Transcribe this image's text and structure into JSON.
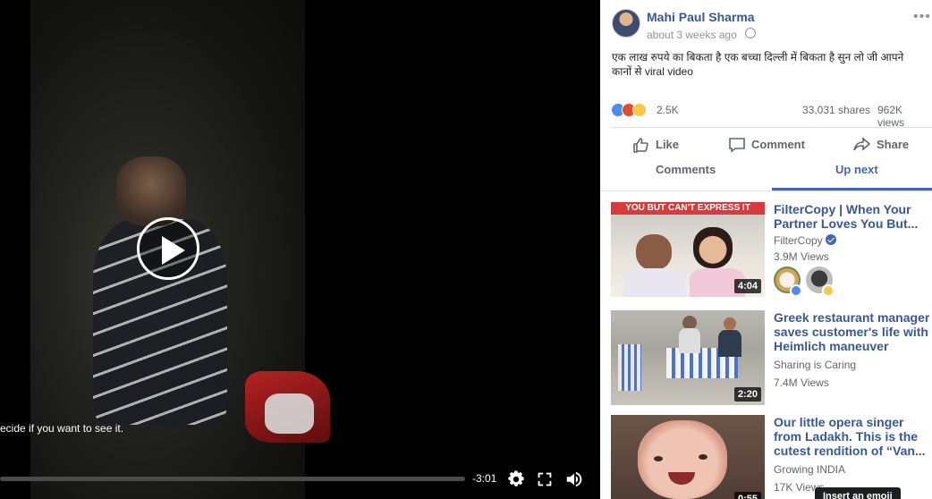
{
  "video": {
    "content_warning": "ecide if you want to see it.",
    "time_remaining": "-3:01",
    "progress": 0.0
  },
  "post": {
    "author": "Mahi Paul Sharma",
    "timestamp": "about 3 weeks ago",
    "caption": "एक लाख रुपये का बिकता है एक बच्चा दिल्ली में बिकता है सुन लो जी आपने कानों से viral video",
    "reaction_count": "2.5K",
    "shares": "33,031 shares",
    "views": "962K views",
    "more_label": "•••"
  },
  "actions": {
    "like": "Like",
    "comment": "Comment",
    "share": "Share"
  },
  "tabs": {
    "comments": "Comments",
    "up_next": "Up next",
    "active": "Up next"
  },
  "up_next": [
    {
      "title": "FilterCopy | When Your Partner Loves You But...",
      "source": "FilterCopy",
      "verified": true,
      "views": "3.9M Views",
      "duration": "4:04",
      "thumb_banner": "YOU BUT CAN'T EXPRESS IT"
    },
    {
      "title": "Greek restaurant manager saves customer's life with Heimlich maneuver",
      "source": "Sharing is Caring",
      "views": "7.4M Views",
      "duration": "2:20"
    },
    {
      "title": "Our little opera singer from Ladakh. This is the cutest rendition of “Van...",
      "source": "Growing INDIA",
      "views": "17K Views",
      "duration": "0:55"
    }
  ],
  "tooltip": "Insert an emoji",
  "colors": {
    "link": "#365899",
    "accent": "#4267b2",
    "meta": "#90949c"
  }
}
